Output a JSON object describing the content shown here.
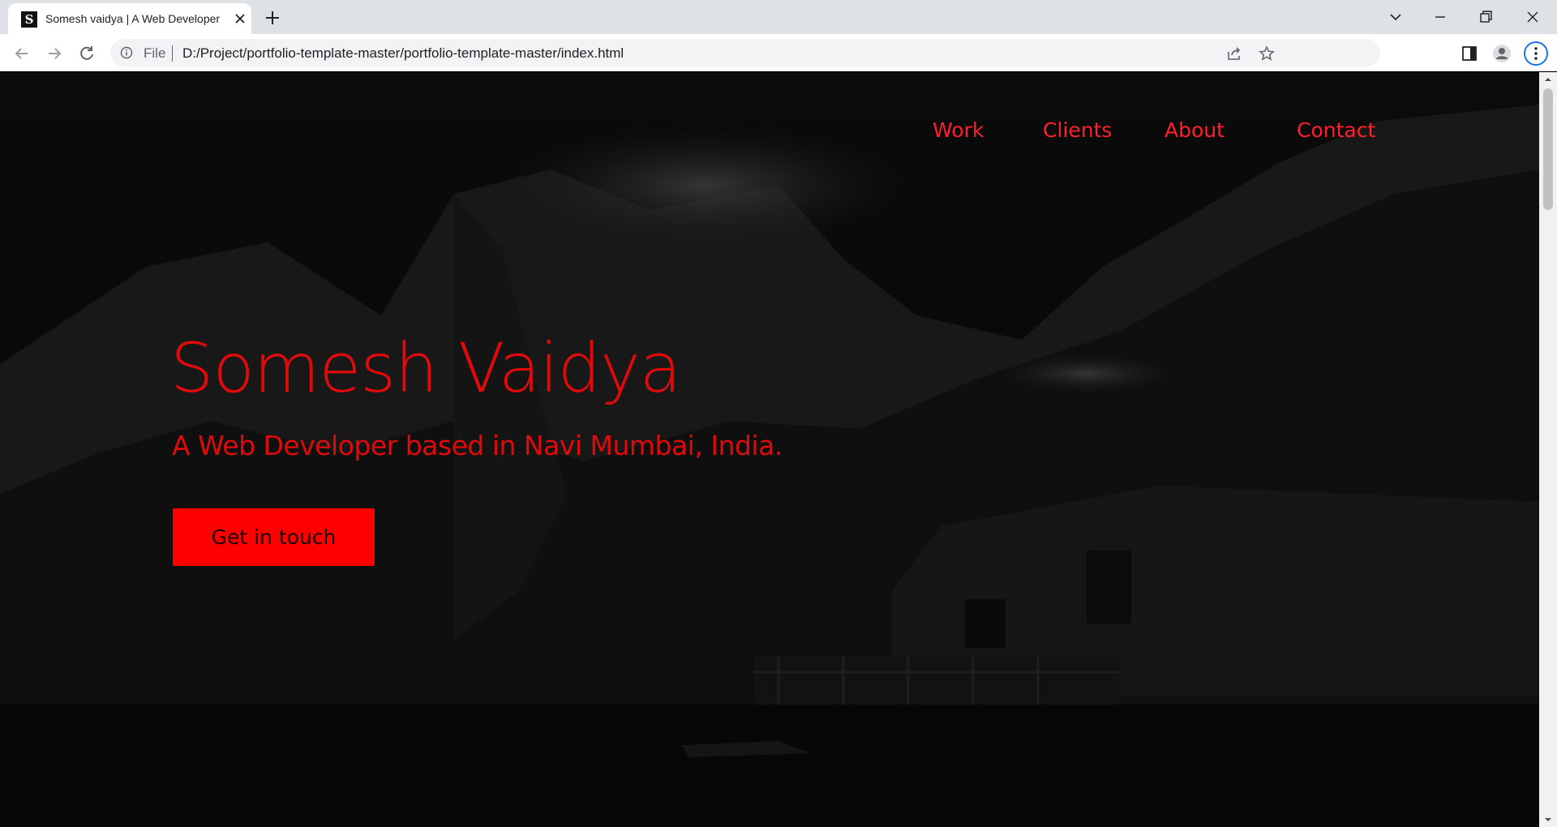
{
  "browser": {
    "tab_title": "Somesh vaidya | A Web Developer",
    "favicon_letter": "S",
    "omnibox_scheme": "File",
    "url": "D:/Project/portfolio-template-master/portfolio-template-master/index.html"
  },
  "site": {
    "nav": [
      "Work",
      "Clients",
      "About",
      "Contact"
    ],
    "hero": {
      "name": "Somesh Vaidya",
      "tagline": "A Web Developer based in Navi Mumbai, India.",
      "cta_label": "Get in touch"
    }
  },
  "colors": {
    "accent_text": "#e10a0a",
    "nav_text": "#ff1f2d",
    "cta_background": "#ff0000",
    "hero_background": "#050505"
  }
}
